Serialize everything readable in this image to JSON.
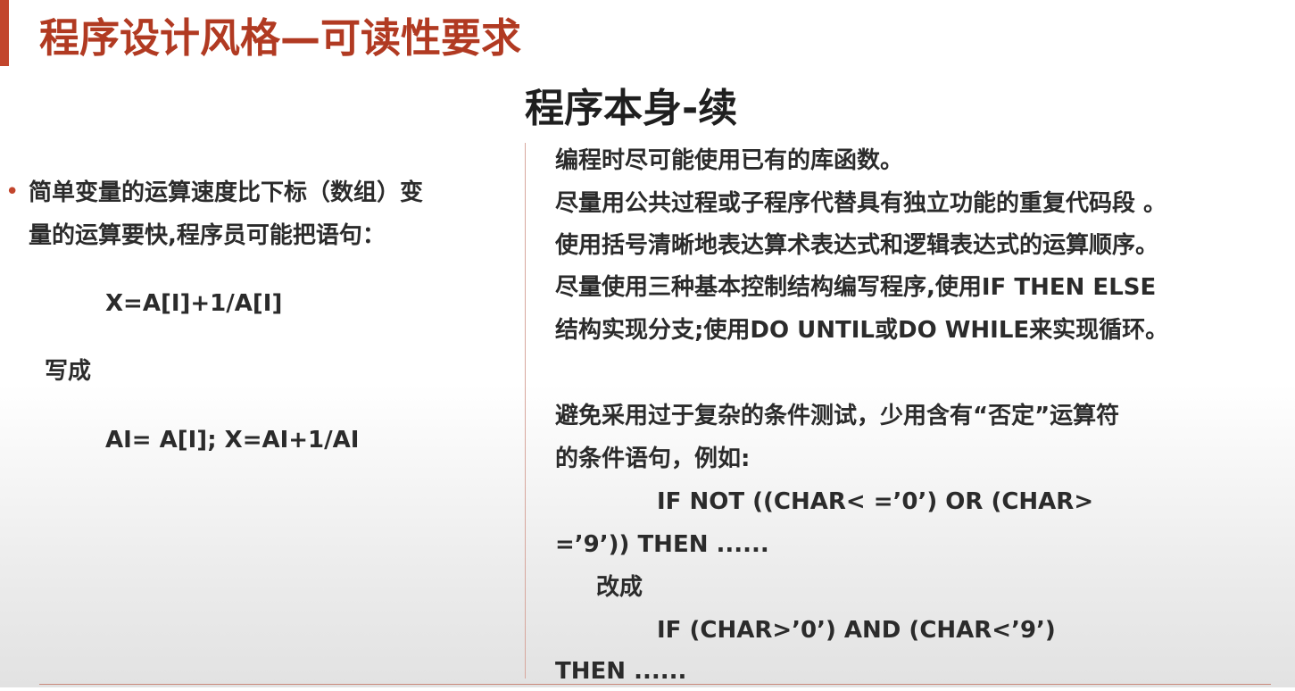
{
  "slide": {
    "title": "程序设计风格—可读性要求",
    "subtitle": "程序本身-续"
  },
  "left": {
    "bullet_line1": "简单变量的运算速度比下标（数组）变",
    "bullet_line2": "量的运算要快,程序员可能把语句：",
    "code1": "X=A[I]+1/A[I]",
    "rewrite_label": "写成",
    "code2": "AI= A[I]; X=AI+1/AI"
  },
  "right": {
    "lines": [
      "编程时尽可能使用已有的库函数。",
      "尽量用公共过程或子程序代替具有独立功能的重复代码段 。",
      "使用括号清晰地表达算术表达式和逻辑表达式的运算顺序。",
      "尽量使用三种基本控制结构编写程序,使用IF  THEN ELSE",
      "结构实现分支;使用DO UNTIL或DO WHILE来实现循环。",
      "避免采用过于复杂的条件测试，少用含有“否定”运算符",
      "的条件语句，例如:",
      "IF NOT ((CHAR< =’0’) OR (CHAR>",
      "=’9’)) THEN ......",
      "改成",
      "IF (CHAR>’0’) AND (CHAR<’9’)",
      "THEN ......"
    ]
  }
}
